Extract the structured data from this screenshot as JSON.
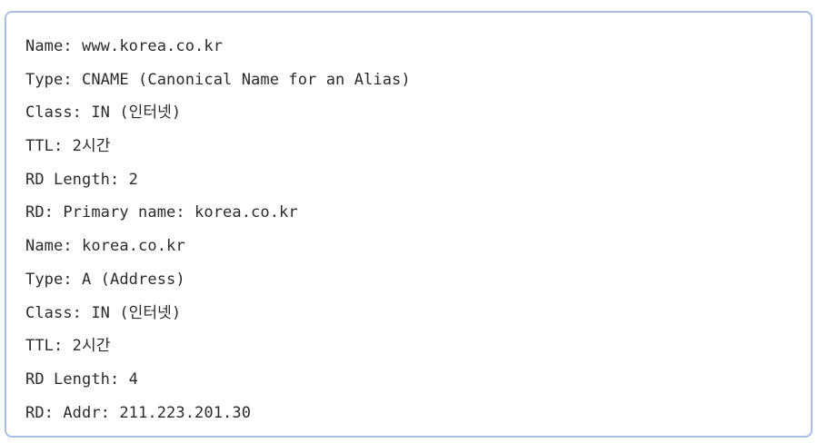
{
  "dns_record": {
    "lines": [
      "Name: www.korea.co.kr",
      "Type: CNAME (Canonical Name for an Alias)",
      "Class: IN (인터넷)",
      "TTL: 2시간",
      "RD Length: 2",
      "RD: Primary name: korea.co.kr",
      "Name: korea.co.kr",
      "Type: A (Address)",
      "Class: IN (인터넷)",
      "TTL: 2시간",
      "RD Length: 4",
      "RD: Addr: 211.223.201.30"
    ]
  },
  "colors": {
    "border": "#a9bce6",
    "text": "#2b2b2b",
    "background": "#ffffff"
  }
}
